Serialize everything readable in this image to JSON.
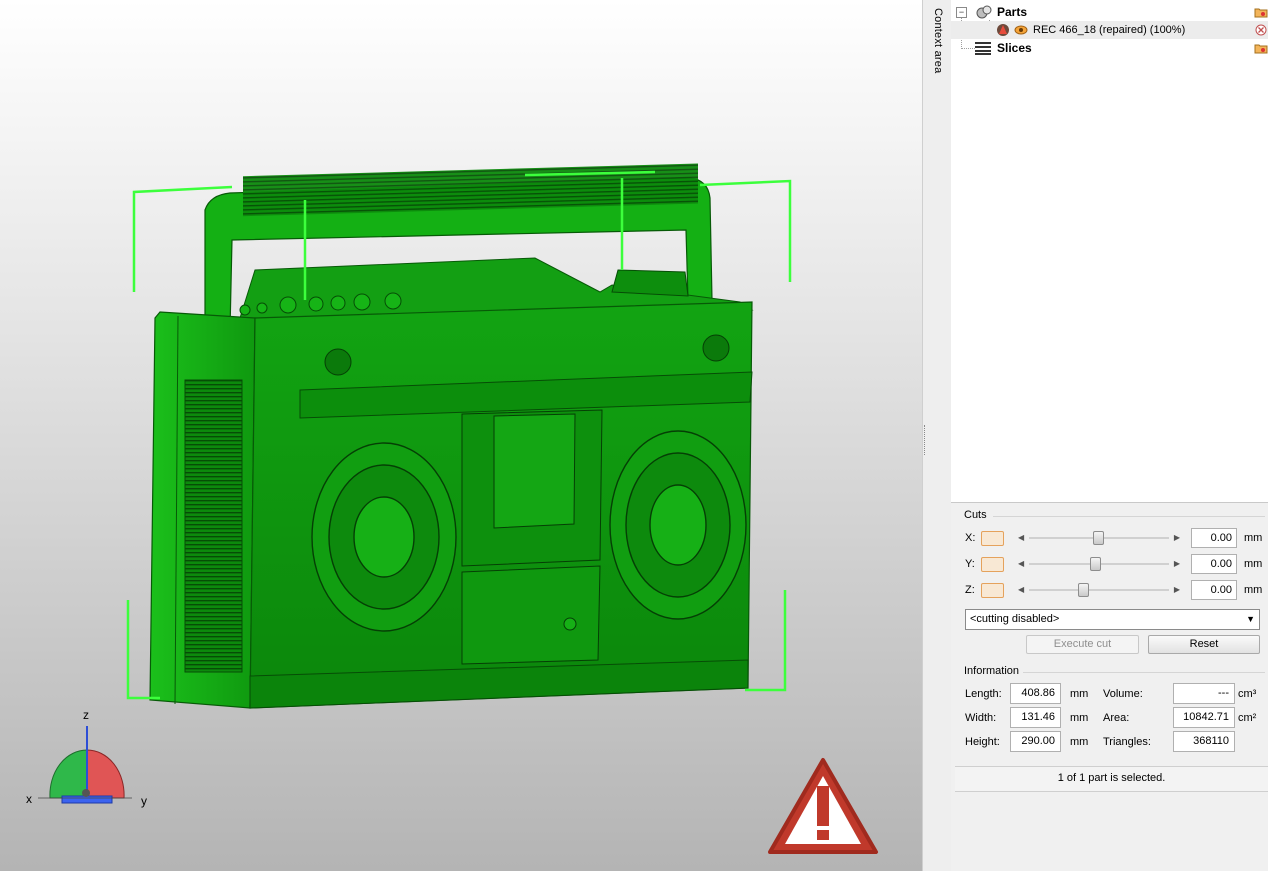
{
  "context_area": {
    "label": "Context area"
  },
  "tree": {
    "parts": {
      "label": "Parts",
      "expander": "−"
    },
    "part_item": {
      "label": "REC 466_18 (repaired) (100%)"
    },
    "slices": {
      "label": "Slices"
    }
  },
  "cuts": {
    "title": "Cuts",
    "axes": [
      {
        "label": "X:",
        "value": "0.00",
        "unit": "mm",
        "slider_pos": 0.5
      },
      {
        "label": "Y:",
        "value": "0.00",
        "unit": "mm",
        "slider_pos": 0.48
      },
      {
        "label": "Z:",
        "value": "0.00",
        "unit": "mm",
        "slider_pos": 0.4
      }
    ],
    "mode": "<cutting disabled>",
    "execute_label": "Execute cut",
    "reset_label": "Reset"
  },
  "information": {
    "title": "Information",
    "length": {
      "label": "Length:",
      "value": "408.86",
      "unit": "mm"
    },
    "width": {
      "label": "Width:",
      "value": "131.46",
      "unit": "mm"
    },
    "height": {
      "label": "Height:",
      "value": "290.00",
      "unit": "mm"
    },
    "volume": {
      "label": "Volume:",
      "value": "---",
      "unit": "cm³"
    },
    "area": {
      "label": "Area:",
      "value": "10842.71",
      "unit": "cm²"
    },
    "triangles": {
      "label": "Triangles:",
      "value": "368110"
    }
  },
  "status": {
    "text": "1 of 1 part is selected."
  },
  "gizmo": {
    "x": "x",
    "y": "y",
    "z": "z"
  },
  "colors": {
    "model": "#12a812",
    "bbox": "#3cff3c",
    "warning": "#c0392b"
  },
  "icons": [
    "folder-icon",
    "close-icon",
    "parts-icon",
    "slices-icon",
    "warning-icon",
    "eye-icon"
  ]
}
